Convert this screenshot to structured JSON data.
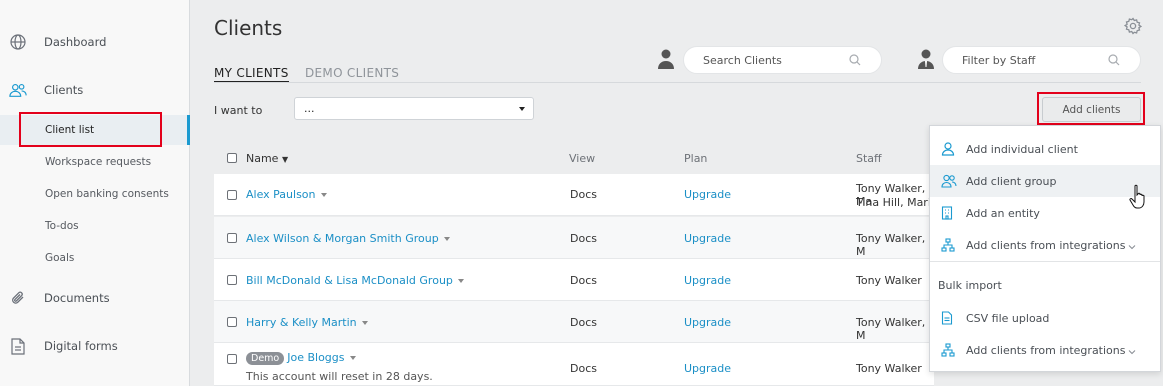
{
  "sidebar": {
    "items": [
      {
        "label": "Dashboard",
        "icon": "globe-icon"
      },
      {
        "label": "Clients",
        "icon": "users-icon"
      },
      {
        "label": "Documents",
        "icon": "paperclip-icon"
      },
      {
        "label": "Digital forms",
        "icon": "document-icon"
      }
    ],
    "sub_items": [
      {
        "label": "Client list"
      },
      {
        "label": "Workspace requests"
      },
      {
        "label": "Open banking consents"
      },
      {
        "label": "To-dos"
      },
      {
        "label": "Goals"
      }
    ]
  },
  "header": {
    "title": "Clients",
    "tabs": [
      {
        "label": "MY CLIENTS"
      },
      {
        "label": "DEMO CLIENTS"
      }
    ],
    "search_placeholder": "Search Clients",
    "filter_placeholder": "Filter by Staff"
  },
  "actions": {
    "i_want_to": "I want to",
    "select_value": "...",
    "add_clients": "Add clients"
  },
  "table": {
    "columns": [
      "Name",
      "View",
      "Plan",
      "Staff"
    ],
    "rows": [
      {
        "name": "Alex Paulson",
        "view": "Docs",
        "plan": "Upgrade",
        "staff": "Tony Walker, Ma",
        "staff2": "Tina Hill, Mari"
      },
      {
        "name": "Alex Wilson & Morgan Smith Group",
        "view": "Docs",
        "plan": "Upgrade",
        "staff": "Tony Walker, M"
      },
      {
        "name": "Bill McDonald & Lisa McDonald Group",
        "view": "Docs",
        "plan": "Upgrade",
        "staff": "Tony Walker"
      },
      {
        "name": "Harry & Kelly Martin",
        "view": "Docs",
        "plan": "Upgrade",
        "staff": "Tony Walker, M"
      },
      {
        "name": "Joe Bloggs",
        "badge": "Demo",
        "note": "This account will reset in 28 days.",
        "view": "Docs",
        "plan": "Upgrade",
        "staff": "Tony Walker"
      }
    ]
  },
  "menu": {
    "items": [
      {
        "label": "Add individual client",
        "icon": "user-icon"
      },
      {
        "label": "Add client group",
        "icon": "users-icon"
      },
      {
        "label": "Add an entity",
        "icon": "building-icon"
      },
      {
        "label": "Add clients from integrations",
        "icon": "hierarchy-icon"
      }
    ],
    "bulk_label": "Bulk import",
    "bulk_items": [
      {
        "label": "CSV file upload",
        "icon": "file-icon"
      },
      {
        "label": "Add clients from integrations",
        "icon": "hierarchy-icon"
      }
    ]
  },
  "colors": {
    "accent": "#1b9ad0",
    "highlight": "#e3001b"
  }
}
